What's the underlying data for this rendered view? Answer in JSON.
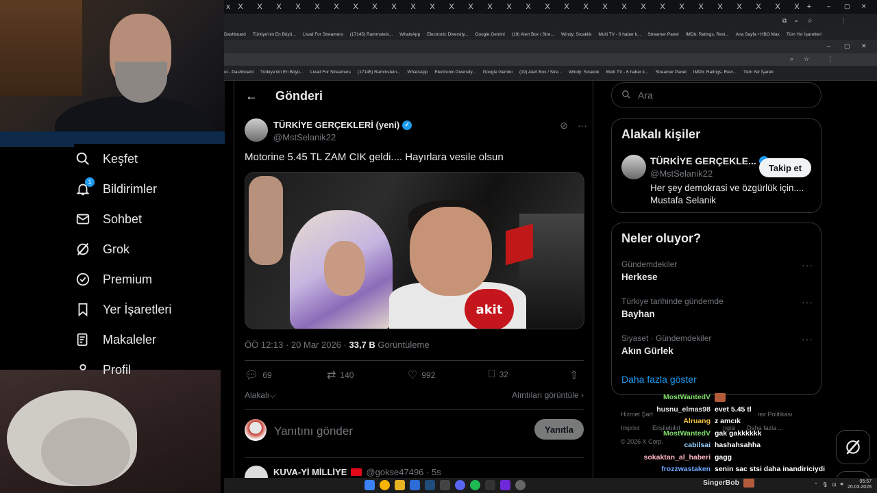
{
  "browser": {
    "bookmarks_top": [
      "Dashboard",
      "Türkiye'nin En Büyü...",
      "Livad For Streamers",
      "(17145) Rammstein...",
      "WhatsApp",
      "Electronic Diversity...",
      "Google Gemini",
      "(19) Alert Box / Stre...",
      "Windy: Sıcaklık",
      "Multi TV - 6 haber k...",
      "Streamer Panel",
      "IMDb: Ratings, Revi...",
      "Ana Sayfa • HBO Max",
      "Tüm Yer İşaretleri"
    ],
    "bookmarks_bottom": [
      "ot - Dashboard",
      "Türkiye'nin En Büyü...",
      "Livad For Streamers",
      "(17145) Rammstein...",
      "WhatsApp",
      "Electronic Diversity...",
      "Google Gemini",
      "(19) Alert Box / Stre...",
      "Windy: Sıcaklık",
      "Multi TV - 6 haber k...",
      "Streamer Panel",
      "IMDb: Ratings, Revi...",
      "Tüm Yer İşareti"
    ]
  },
  "nav": {
    "items": [
      {
        "label": "Keşfet",
        "icon": "search-icon"
      },
      {
        "label": "Bildirimler",
        "icon": "bell-icon",
        "badge": "1"
      },
      {
        "label": "Sohbet",
        "icon": "mail-icon"
      },
      {
        "label": "Grok",
        "icon": "grok-icon"
      },
      {
        "label": "Premium",
        "icon": "verified-badge-icon"
      },
      {
        "label": "Yer İşaretleri",
        "icon": "bookmark-icon"
      },
      {
        "label": "Makaleler",
        "icon": "article-icon"
      },
      {
        "label": "Profil",
        "icon": "user-icon"
      }
    ]
  },
  "post": {
    "header_title": "Gönderi",
    "author_name": "TÜRKİYE GERÇEKLERİ (yeni)",
    "author_handle": "@MstSelanik22",
    "text": "Motorine 5.45 TL ZAM CIK geldi.... Hayırlara vesile olsun",
    "media_label": "akit",
    "time": "ÖÖ 12:13 · 20 Mar 2026 ·",
    "views": "33,7 B",
    "views_label": "Görüntüleme",
    "replies": "69",
    "reposts": "140",
    "likes": "992",
    "bookmarks": "32",
    "related_label": "Alakalı",
    "quotes_label": "Alıntıları görüntüle",
    "reply_placeholder": "Yanıtını gönder",
    "reply_button": "Yanıtla",
    "next_name": "KUVA-Yİ MİLLİYE",
    "next_handle": "@gokse47496 · 5s"
  },
  "sidebar": {
    "search_placeholder": "Ara",
    "relevant_title": "Alakalı kişiler",
    "rel_name": "TÜRKİYE GERÇEKLE...",
    "rel_handle": "@MstSelanik22",
    "follow_label": "Takip et",
    "rel_bio": "Her şey demokrasi ve özgürlük için.... Mustafa Selanik",
    "trends_title": "Neler oluyor?",
    "trends": [
      {
        "context": "Gündemdekiler",
        "topic": "Herkese"
      },
      {
        "context": "Türkiye tarihinde gündemde",
        "topic": "Bayhan"
      },
      {
        "context": "Siyaset · Gündemdekiler",
        "topic": "Akın Gürlek"
      }
    ],
    "show_more": "Daha fazla göster",
    "footer": [
      "Hizmet Şart",
      "rez Politikası",
      "Imprint",
      "Erişilebilirl",
      "ngisi",
      "Daha fazla ...",
      "© 2026 X Corp."
    ]
  },
  "chat": [
    {
      "user": "MostWantedV",
      "msg": "",
      "color": "#7fdc6a",
      "emote": true
    },
    {
      "user": "husnu_elmas98",
      "msg": "evet 5.45 tl",
      "color": "#e6e6e6"
    },
    {
      "user": "Alruang",
      "msg": "z amcık",
      "color": "#f0c040"
    },
    {
      "user": "MostWantedV",
      "msg": "gak gakkkkkk",
      "color": "#7fdc6a"
    },
    {
      "user": "cabilsai",
      "msg": "hashahsahha",
      "color": "#9ad0ff"
    },
    {
      "user": "sokaktan_al_haberi",
      "msg": "gagg",
      "color": "#ffb6c1"
    },
    {
      "user": "frozzwastaken",
      "msg": "senin sac stsi daha inandiriciydi",
      "color": "#6aa8ff"
    }
  ],
  "stream": {
    "singer": "SingerBob"
  },
  "taskbar": {
    "time": "05:57",
    "date": "20.03.2026"
  }
}
